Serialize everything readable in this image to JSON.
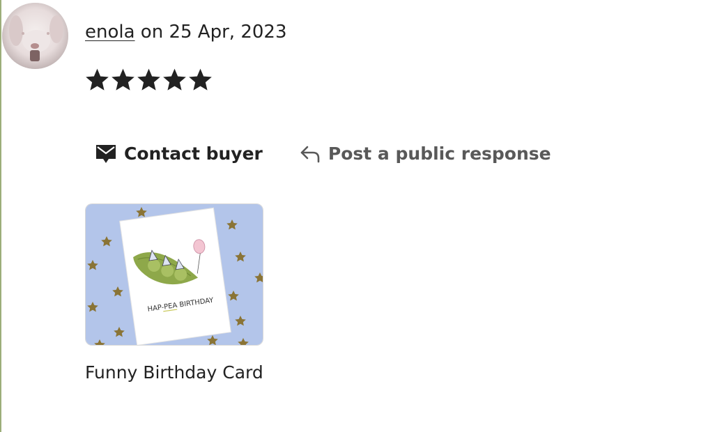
{
  "review": {
    "reviewer_name": "enola",
    "date_text": " on 25 Apr, 2023",
    "rating": 5,
    "rating_max": 5,
    "star_color": "#222222"
  },
  "actions": {
    "contact_label": "Contact buyer",
    "contact_icon": "envelope-icon",
    "public_label": "Post a public response",
    "public_icon": "reply-arrow-icon"
  },
  "product": {
    "title": "Funny Birthday Card",
    "card_text": "HAP-PEA BIRTHDAY",
    "background_color": "#b3c5ea",
    "accent_color": "#9cae7a"
  }
}
